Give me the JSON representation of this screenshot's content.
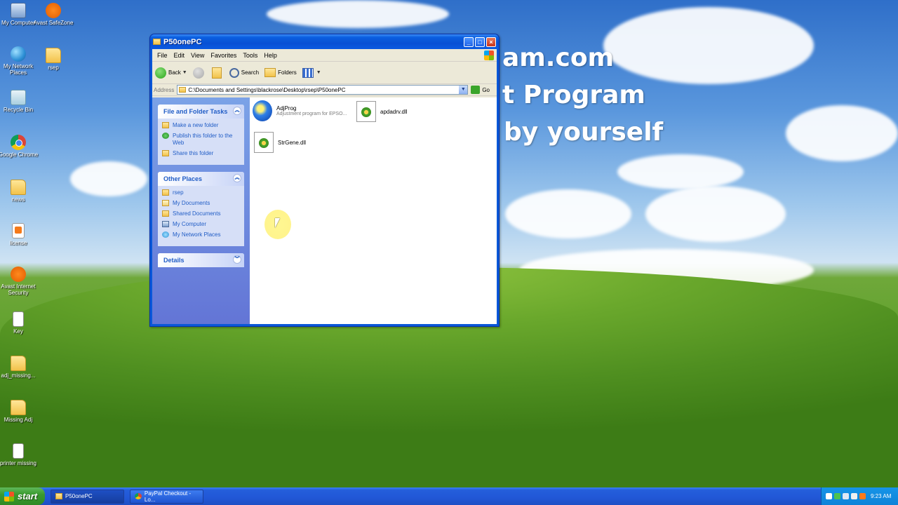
{
  "overlay": {
    "line1": "am.com",
    "line2": "t Program",
    "line3": "by yourself"
  },
  "desktop_icons": [
    {
      "label": "My Computer",
      "icon": "computer-icon"
    },
    {
      "label": "Avast SafeZone",
      "icon": "avast-safezone-icon"
    },
    {
      "label": "My Network Places",
      "icon": "network-places-icon"
    },
    {
      "label": "rsep",
      "icon": "folder-icon"
    },
    {
      "label": "Recycle Bin",
      "icon": "recycle-bin-icon"
    },
    {
      "label": "Google Chrome",
      "icon": "chrome-icon"
    },
    {
      "label": "news",
      "icon": "folder-icon"
    },
    {
      "label": "license",
      "icon": "license-icon"
    },
    {
      "label": "Avast Internet Security",
      "icon": "avast-icon"
    },
    {
      "label": "Key",
      "icon": "document-icon"
    },
    {
      "label": "adj_missing...",
      "icon": "folder-icon"
    },
    {
      "label": "Missing Adj",
      "icon": "folder-icon"
    },
    {
      "label": "printer missing",
      "icon": "document-icon"
    }
  ],
  "window": {
    "title": "P50onePC",
    "menu": [
      "File",
      "Edit",
      "View",
      "Favorites",
      "Tools",
      "Help"
    ],
    "toolbar": {
      "back_label": "Back",
      "search_label": "Search",
      "folders_label": "Folders"
    },
    "address": {
      "label": "Address",
      "value": "C:\\Documents and Settings\\blackrose\\Desktop\\rsep\\P50onePC",
      "go_label": "Go"
    },
    "tasks_panel": {
      "title": "File and Folder Tasks",
      "links": [
        "Make a new folder",
        "Publish this folder to the Web",
        "Share this folder"
      ]
    },
    "places_panel": {
      "title": "Other Places",
      "links": [
        "rsep",
        "My Documents",
        "Shared Documents",
        "My Computer",
        "My Network Places"
      ]
    },
    "details_panel": {
      "title": "Details"
    },
    "files": [
      {
        "name": "AdjProg",
        "desc": "Adjustment program for EPSO...",
        "icon": "adjprog-icon"
      },
      {
        "name": "apdadrv.dll",
        "desc": "",
        "icon": "dll-icon"
      },
      {
        "name": "StrGene.dll",
        "desc": "",
        "icon": "dll-icon"
      }
    ]
  },
  "taskbar": {
    "start_label": "start",
    "tasks": [
      "P50onePC",
      "PayPal Checkout - Lo..."
    ],
    "clock": "9:23 AM"
  }
}
